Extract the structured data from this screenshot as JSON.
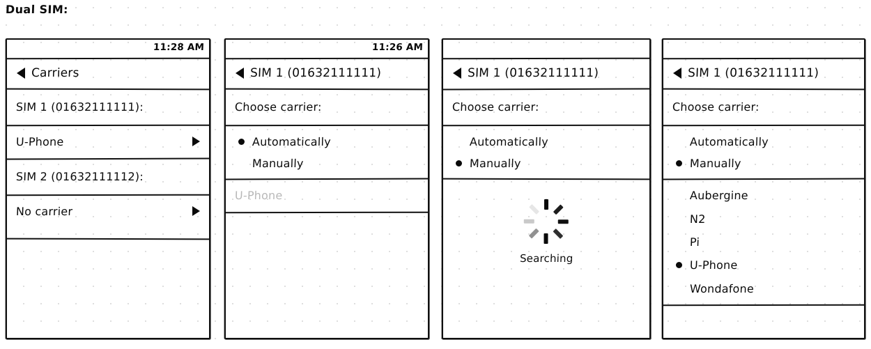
{
  "sheet": {
    "title": "Dual SIM:"
  },
  "panels": [
    {
      "id": "carriers-list",
      "statusbar": {
        "clock": "11:28 AM"
      },
      "nav": {
        "back_icon": "back-triangle-icon",
        "title": "Carriers"
      },
      "rows": [
        {
          "label": "SIM 1 (01632111111):",
          "chevron": false,
          "dim": false
        },
        {
          "label": "U-Phone",
          "chevron": true,
          "dim": false
        },
        {
          "label": "SIM 2 (01632111112):",
          "chevron": false,
          "dim": false
        },
        {
          "label": "No carrier",
          "chevron": true,
          "dim": false
        }
      ]
    },
    {
      "id": "choose-carrier-automatic",
      "statusbar": {
        "clock": "11:26 AM"
      },
      "nav": {
        "back_icon": "back-triangle-icon",
        "title": "SIM 1 (01632111111)"
      },
      "section_label": "Choose carrier:",
      "options": [
        {
          "label": "Automatically",
          "selected": true
        },
        {
          "label": "Manually",
          "selected": false
        }
      ],
      "result_row": {
        "label": "U-Phone",
        "dim": true
      }
    },
    {
      "id": "choose-carrier-searching",
      "statusbar": {
        "clock": ""
      },
      "nav": {
        "back_icon": "back-triangle-icon",
        "title": "SIM 1 (01632111111)"
      },
      "section_label": "Choose carrier:",
      "options": [
        {
          "label": "Automatically",
          "selected": false
        },
        {
          "label": "Manually",
          "selected": true
        }
      ],
      "spinner": {
        "icon": "loading-spinner-icon",
        "label": "Searching"
      }
    },
    {
      "id": "choose-carrier-results",
      "statusbar": {
        "clock": ""
      },
      "nav": {
        "back_icon": "back-triangle-icon",
        "title": "SIM 1 (01632111111)"
      },
      "section_label": "Choose carrier:",
      "options": [
        {
          "label": "Automatically",
          "selected": false
        },
        {
          "label": "Manually",
          "selected": true
        }
      ],
      "carriers": [
        {
          "label": "Aubergine",
          "selected": false
        },
        {
          "label": "N2",
          "selected": false
        },
        {
          "label": "Pi",
          "selected": false
        },
        {
          "label": "U-Phone",
          "selected": true
        },
        {
          "label": "Wondafone",
          "selected": false
        }
      ]
    }
  ]
}
